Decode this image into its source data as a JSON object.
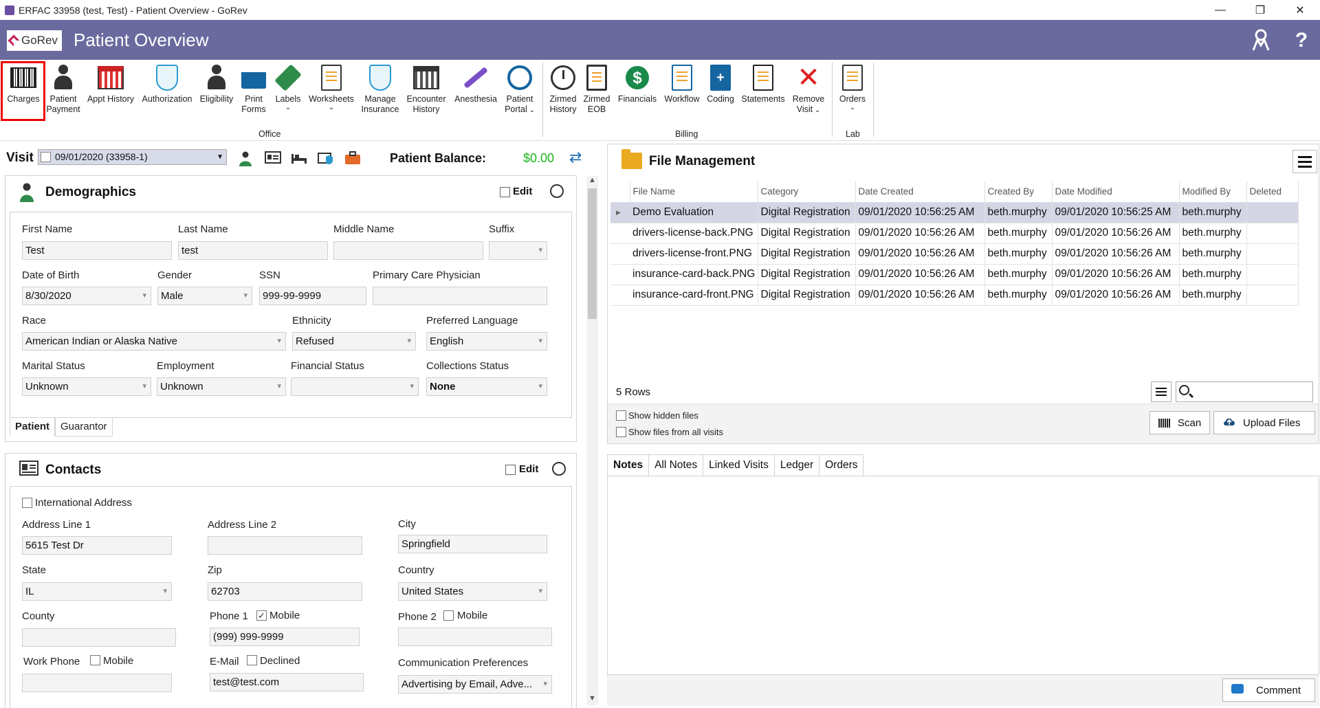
{
  "window": {
    "title": "ERFAC 33958 (test, Test) - Patient Overview - GoRev",
    "minimize": "—",
    "restore": "❐",
    "close": "✕"
  },
  "header": {
    "logo_text": "GoRev",
    "page_title": "Patient Overview",
    "help": "?"
  },
  "ribbon": {
    "charges": "Charges",
    "patient_payment": [
      "Patient",
      "Payment"
    ],
    "appt_history": "Appt History",
    "authorization": "Authorization",
    "eligibility": "Eligibility",
    "print_forms": [
      "Print",
      "Forms"
    ],
    "labels": "Labels",
    "worksheets": "Worksheets",
    "manage_insurance": [
      "Manage",
      "Insurance"
    ],
    "encounter_history": [
      "Encounter",
      "History"
    ],
    "anesthesia": "Anesthesia",
    "patient_portal": [
      "Patient",
      "Portal"
    ],
    "zirmed_history": [
      "Zirmed",
      "History"
    ],
    "zirmed_eob": [
      "Zirmed",
      "EOB"
    ],
    "financials": "Financials",
    "workflow": "Workflow",
    "coding": "Coding",
    "statements": "Statements",
    "remove_visit": [
      "Remove",
      "Visit"
    ],
    "orders": "Orders",
    "groups": {
      "office": "Office",
      "billing": "Billing",
      "lab": "Lab"
    },
    "financials_symbol": "$"
  },
  "visit": {
    "label": "Visit",
    "selected": "09/01/2020 (33958-1)",
    "balance_label": "Patient Balance:",
    "balance_value": "$0.00"
  },
  "demographics": {
    "title": "Demographics",
    "edit": "Edit",
    "first_name_label": "First Name",
    "first_name": "Test",
    "last_name_label": "Last Name",
    "last_name": "test",
    "middle_name_label": "Middle Name",
    "middle_name": "",
    "suffix_label": "Suffix",
    "suffix": "",
    "dob_label": "Date of Birth",
    "dob": "8/30/2020",
    "gender_label": "Gender",
    "gender": "Male",
    "ssn_label": "SSN",
    "ssn": "999-99-9999",
    "pcp_label": "Primary Care Physician",
    "pcp": "",
    "race_label": "Race",
    "race": "American Indian or Alaska Native",
    "ethnicity_label": "Ethnicity",
    "ethnicity": "Refused",
    "language_label": "Preferred Language",
    "language": "English",
    "marital_label": "Marital Status",
    "marital": "Unknown",
    "employment_label": "Employment",
    "employment": "Unknown",
    "financial_label": "Financial Status",
    "financial": "",
    "collections_label": "Collections Status",
    "collections": "None",
    "tabs": [
      "Patient",
      "Guarantor"
    ]
  },
  "contacts": {
    "title": "Contacts",
    "edit": "Edit",
    "intl_address": "International Address",
    "addr1_label": "Address Line 1",
    "addr1": "5615 Test Dr",
    "addr2_label": "Address Line 2",
    "addr2": "",
    "city_label": "City",
    "city": "Springfield",
    "state_label": "State",
    "state": "IL",
    "zip_label": "Zip",
    "zip": "62703",
    "country_label": "Country",
    "country": "United States",
    "county_label": "County",
    "county": "",
    "phone1_label": "Phone 1",
    "phone1_mobile": "Mobile",
    "phone1": "(999) 999-9999",
    "phone2_label": "Phone 2",
    "phone2_mobile": "Mobile",
    "phone2": "",
    "work_label": "Work Phone",
    "work_mobile": "Mobile",
    "work_phone": "",
    "email_label": "E-Mail",
    "email_declined": "Declined",
    "email": "test@test.com",
    "comm_label": "Communication Preferences",
    "comm": "Advertising by Email, Adve...",
    "checkmark": "✓"
  },
  "file_management": {
    "title": "File Management",
    "columns": [
      "File Name",
      "Category",
      "Date Created",
      "Created By",
      "Date Modified",
      "Modified By",
      "Deleted"
    ],
    "rows": [
      [
        "Demo Evaluation",
        "Digital Registration",
        "09/01/2020 10:56:25 AM",
        "beth.murphy",
        "09/01/2020 10:56:25 AM",
        "beth.murphy",
        ""
      ],
      [
        "drivers-license-back.PNG",
        "Digital Registration",
        "09/01/2020 10:56:26 AM",
        "beth.murphy",
        "09/01/2020 10:56:26 AM",
        "beth.murphy",
        ""
      ],
      [
        "drivers-license-front.PNG",
        "Digital Registration",
        "09/01/2020 10:56:26 AM",
        "beth.murphy",
        "09/01/2020 10:56:26 AM",
        "beth.murphy",
        ""
      ],
      [
        "insurance-card-back.PNG",
        "Digital Registration",
        "09/01/2020 10:56:26 AM",
        "beth.murphy",
        "09/01/2020 10:56:26 AM",
        "beth.murphy",
        ""
      ],
      [
        "insurance-card-front.PNG",
        "Digital Registration",
        "09/01/2020 10:56:26 AM",
        "beth.murphy",
        "09/01/2020 10:56:26 AM",
        "beth.murphy",
        ""
      ]
    ],
    "row_count": "5 Rows",
    "search_value": "",
    "show_hidden": "Show hidden files",
    "show_all_visits": "Show files from all visits",
    "scan": "Scan",
    "upload": "Upload Files"
  },
  "notes": {
    "tabs": [
      "Notes",
      "All Notes",
      "Linked Visits",
      "Ledger",
      "Orders"
    ],
    "comment": "Comment"
  },
  "colors": {
    "header_bg": "#6a6a9e",
    "balance": "#1db41d",
    "selection_outline": "#e00000",
    "selected_row": "#d4d6e6"
  }
}
